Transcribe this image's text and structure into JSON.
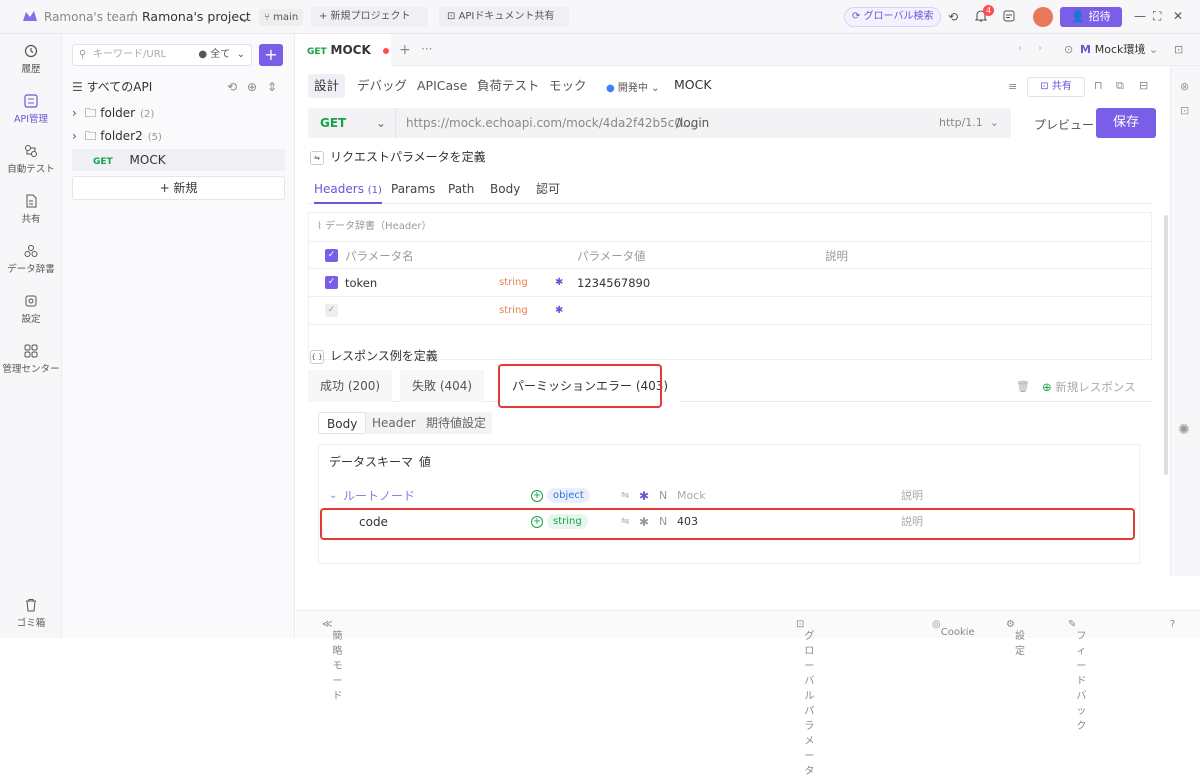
{
  "topbar": {
    "team": "Ramona's team",
    "separator": "/",
    "project": "Ramona's project",
    "branch": "main",
    "new_project": "+ 新規プロジェクト",
    "api_share": "APIドキュメント共有",
    "global_search": "グローバル検索",
    "notif_count": "4",
    "invite": "招待"
  },
  "nav": {
    "history": "履歴",
    "api": "API管理",
    "auto_test": "自動テスト",
    "share": "共有",
    "data_dict": "データ辞書",
    "settings": "設定",
    "admin": "管理センター",
    "trash": "ゴミ箱"
  },
  "sidebar": {
    "search_placeholder": "キーワード/URL",
    "filter": "全て",
    "all_apis": "すべてのAPI",
    "folders": [
      {
        "name": "folder",
        "count": "(2)"
      },
      {
        "name": "folder2",
        "count": "(5)"
      }
    ],
    "api": {
      "method": "GET",
      "name": "MOCK"
    },
    "new": "+ 新規"
  },
  "tab": {
    "method": "GET",
    "name": "MOCK"
  },
  "env": "Mock環境",
  "subtabs": [
    "設計",
    "デバッグ",
    "APICase",
    "負荷テスト",
    "モック"
  ],
  "status": "開発中",
  "api_name": "MOCK",
  "share": "共有",
  "url": {
    "method": "GET",
    "base": "https://mock.echoapi.com/mock/4da2f42b5c0...",
    "path": "/login",
    "protocol": "http/1.1",
    "preview": "プレビュー",
    "save": "保存"
  },
  "request_title": "リクエストパラメータを定義",
  "param_tabs": {
    "headers": "Headers",
    "headers_count": "(1)",
    "params": "Params",
    "path": "Path",
    "body": "Body",
    "auth": "認可"
  },
  "dict_label": "データ辞書（Header）",
  "param_table": {
    "col_name": "パラメータ名",
    "col_value": "パラメータ値",
    "col_desc": "説明",
    "rows": [
      {
        "name": "token",
        "type": "string",
        "value": "1234567890"
      },
      {
        "name": "",
        "type": "string",
        "value": ""
      }
    ]
  },
  "response_title": "レスポンス例を定義",
  "response_tabs": [
    "成功 (200)",
    "失敗 (404)",
    "パーミッションエラー (403)"
  ],
  "new_response": "新規レスポンス",
  "body_tabs": [
    "Body",
    "Header",
    "期待値設定"
  ],
  "schema": {
    "tab1": "データスキーマ",
    "tab2": "値",
    "root": "ルートノード",
    "root_type": "object",
    "mock_label": "Mock",
    "desc_label": "説明",
    "field": "code",
    "field_type": "string",
    "field_value": "403",
    "n_label": "N"
  },
  "footer": {
    "simple_mode": "簡略モード",
    "global_params": "グローバルパラメータ",
    "cookie": "Cookie",
    "settings": "設定",
    "feedback": "フィードバック"
  }
}
